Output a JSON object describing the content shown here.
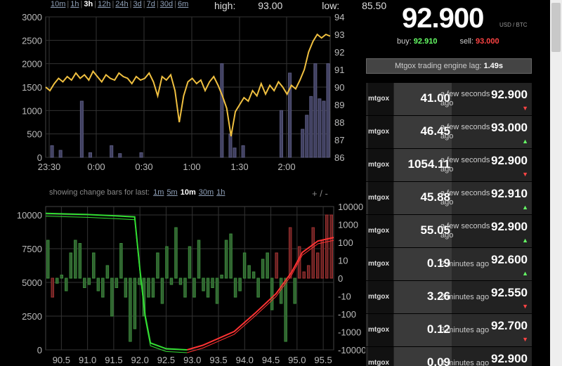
{
  "range_nav": [
    {
      "label": "10m",
      "active": false
    },
    {
      "label": "1h",
      "active": false
    },
    {
      "label": "3h",
      "active": true
    },
    {
      "label": "12h",
      "active": false
    },
    {
      "label": "24h",
      "active": false
    },
    {
      "label": "3d",
      "active": false
    },
    {
      "label": "7d",
      "active": false
    },
    {
      "label": "30d",
      "active": false
    },
    {
      "label": "6m",
      "active": false
    }
  ],
  "stats": {
    "high_label": "high:",
    "high": "93.00",
    "low_label": "low:",
    "low": "85.50"
  },
  "ticker": {
    "last_price": "92.900",
    "unit": "USD / BTC",
    "buy_label": "buy:",
    "buy": "92.910",
    "sell_label": "sell:",
    "sell": "93.000",
    "lag_label": "Mtgox trading engine lag:",
    "lag": "1.49s"
  },
  "depth_header": {
    "label": "showing change bars for last:",
    "options": [
      {
        "label": "1m",
        "active": false
      },
      {
        "label": "5m",
        "active": false
      },
      {
        "label": "10m",
        "active": true
      },
      {
        "label": "30m",
        "active": false
      },
      {
        "label": "1h",
        "active": false
      }
    ],
    "zoom_in": "+",
    "zoom_sep": "/",
    "zoom_out": "-"
  },
  "trades": [
    {
      "exchange": "mtgox",
      "amount": "41.00",
      "time": "a few seconds ago",
      "price": "92.900",
      "dir": "down"
    },
    {
      "exchange": "mtgox",
      "amount": "46.45",
      "time": "a few seconds ago",
      "price": "93.000",
      "dir": "up"
    },
    {
      "exchange": "mtgox",
      "amount": "1054.11",
      "time": "a few seconds ago",
      "price": "92.900",
      "dir": "down"
    },
    {
      "exchange": "mtgox",
      "amount": "45.88",
      "time": "a few seconds ago",
      "price": "92.910",
      "dir": "up"
    },
    {
      "exchange": "mtgox",
      "amount": "55.05",
      "time": "a few seconds ago",
      "price": "92.900",
      "dir": "up"
    },
    {
      "exchange": "mtgox",
      "amount": "0.19",
      "time": "2 minutes ago",
      "price": "92.600",
      "dir": "up"
    },
    {
      "exchange": "mtgox",
      "amount": "3.26",
      "time": "2 minutes ago",
      "price": "92.550",
      "dir": "down"
    },
    {
      "exchange": "mtgox",
      "amount": "0.12",
      "time": "3 minutes ago",
      "price": "92.700",
      "dir": "down"
    },
    {
      "exchange": "mtgox",
      "amount": "0.09",
      "time": "3 minutes ago",
      "price": "92.900",
      "dir": "down"
    }
  ],
  "colors": {
    "price_line": "#f0c040",
    "volume_bar": "#404060",
    "bid": "#33dd33",
    "ask": "#ff3333",
    "change_pos": "#306030",
    "change_neg": "#602020"
  },
  "chart_data": [
    {
      "type": "line",
      "x_ticks": [
        "23:30",
        "0:00",
        "0:30",
        "1:00",
        "1:30",
        "2:00"
      ],
      "y_left_ticks": [
        "3000",
        "2500",
        "2000",
        "1500",
        "1000",
        "500",
        "0"
      ],
      "y_right_ticks": [
        "94",
        "93",
        "92",
        "91",
        "90",
        "89",
        "88",
        "87",
        "86"
      ],
      "ylim_right": [
        86,
        94
      ],
      "ylim_left": [
        0,
        3000
      ],
      "grid": true,
      "series": [
        {
          "kind": "price",
          "axis": "right",
          "values": [
            90.0,
            89.8,
            90.2,
            90.5,
            90.3,
            90.6,
            90.4,
            90.8,
            90.5,
            90.7,
            90.4,
            90.9,
            90.6,
            90.3,
            90.7,
            90.5,
            90.4,
            90.8,
            90.6,
            90.5,
            90.2,
            90.6,
            90.4,
            90.5,
            90.8,
            90.3,
            89.5,
            90.6,
            90.4,
            90.7,
            89.8,
            88.0,
            89.5,
            90.3,
            90.5,
            90.2,
            90.4,
            89.8,
            90.3,
            90.6,
            90.1,
            89.5,
            88.8,
            87.2,
            88.6,
            89.0,
            89.4,
            89.2,
            89.8,
            89.5,
            90.2,
            89.6,
            90.1,
            89.8,
            90.3,
            90.0,
            89.6,
            90.1,
            89.9,
            90.4,
            91.0,
            92.0,
            92.6,
            93.0,
            92.8,
            93.0,
            92.9
          ]
        },
        {
          "kind": "volume",
          "axis": "left",
          "values": [
            0,
            250,
            0,
            150,
            0,
            0,
            0,
            0,
            1200,
            0,
            100,
            0,
            0,
            0,
            0,
            250,
            0,
            80,
            0,
            0,
            0,
            0,
            100,
            0,
            0,
            0,
            0,
            0,
            0,
            0,
            0,
            0,
            0,
            0,
            0,
            0,
            0,
            0,
            0,
            0,
            0,
            2000,
            0,
            500,
            200,
            0,
            250,
            0,
            0,
            0,
            0,
            0,
            0,
            0,
            0,
            1000,
            0,
            1800,
            0,
            0,
            600,
            900,
            1300,
            2000,
            1250,
            1200,
            2000
          ]
        }
      ]
    },
    {
      "type": "area",
      "x_ticks": [
        "90.5",
        "91.0",
        "91.5",
        "92.0",
        "92.5",
        "93.0",
        "93.5",
        "94.0",
        "94.5",
        "95.0",
        "95.5"
      ],
      "xlim": [
        90.2,
        95.7
      ],
      "y_left_ticks": [
        "10000",
        "7500",
        "5000",
        "2500",
        "0"
      ],
      "ylim_left": [
        0,
        12500
      ],
      "y_right_ticks": [
        "10000",
        "1000",
        "100",
        "10",
        "0",
        "-10",
        "-100",
        "-1000",
        "-10000"
      ],
      "grid": true,
      "series": [
        {
          "name": "bids",
          "kind": "depth",
          "x": [
            90.2,
            91.0,
            91.5,
            91.9,
            92.0,
            92.1,
            92.2,
            92.5,
            92.9
          ],
          "values": [
            11900,
            11800,
            11700,
            11600,
            7000,
            3000,
            600,
            100,
            0
          ]
        },
        {
          "name": "asks",
          "kind": "depth",
          "x": [
            92.9,
            93.2,
            93.8,
            94.2,
            94.6,
            94.9,
            95.1,
            95.4,
            95.7
          ],
          "values": [
            0,
            400,
            1600,
            3200,
            4900,
            6800,
            8500,
            9500,
            9800
          ]
        },
        {
          "name": "change",
          "kind": "bars",
          "values": [
            60,
            -30,
            -8,
            5,
            -20,
            40,
            60,
            55,
            -15,
            -10,
            40,
            -20,
            -30,
            20,
            -60,
            -15,
            55,
            -30,
            -100,
            -80,
            -10,
            -60,
            -30,
            -30,
            40,
            -40,
            50,
            -10,
            80,
            -10,
            -30,
            50,
            -30,
            60,
            -20,
            -30,
            -15,
            -40,
            5,
            60,
            70,
            -30,
            -20,
            40,
            20,
            10,
            -30,
            30,
            40,
            -50,
            40,
            -40,
            -100,
            80,
            -40,
            50,
            10,
            20,
            80,
            40,
            60,
            100,
            100
          ]
        }
      ]
    }
  ]
}
